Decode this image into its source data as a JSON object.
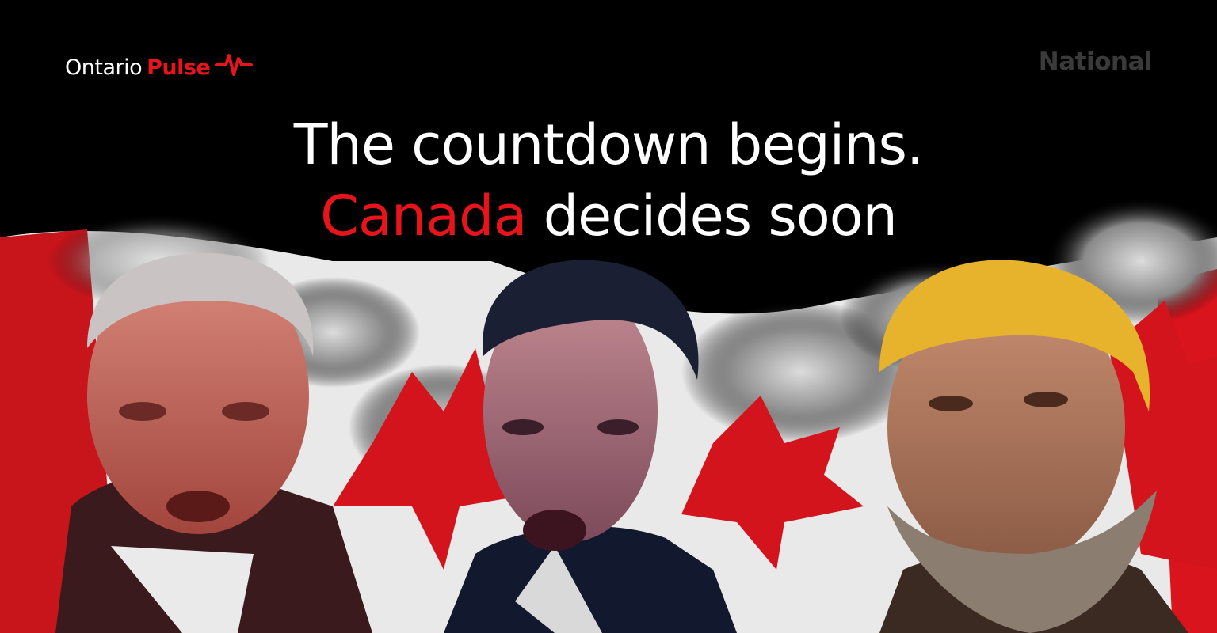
{
  "brand": {
    "name": "Ontario",
    "accent": "Pulse",
    "icon": "pulse-heartbeat-icon"
  },
  "section": {
    "label": "National"
  },
  "headline": {
    "line1": "The countdown begins.",
    "line2_accent": "Canada",
    "line2_rest": " decides soon"
  },
  "colors": {
    "background": "#000000",
    "accent_red": "#e8141c",
    "text_white": "#ffffff",
    "section_gray": "#3a3a3a"
  }
}
